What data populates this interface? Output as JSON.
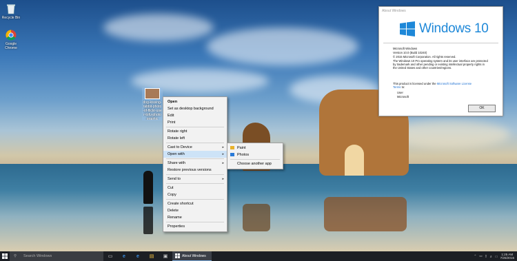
{
  "desktop": {
    "icons": [
      {
        "label": "Recycle Bin"
      },
      {
        "label": "Google Chrome"
      },
      {
        "label": "dog-kissing-rabbit-photo-of-flickr-user-tofu-photographic"
      }
    ]
  },
  "context_menu": {
    "items": [
      {
        "label": "Open",
        "bold": true
      },
      {
        "label": "Set as desktop background"
      },
      {
        "label": "Edit"
      },
      {
        "label": "Print"
      },
      {
        "label": "Rotate right"
      },
      {
        "label": "Rotate left"
      },
      {
        "label": "Cast to Device"
      },
      {
        "label": "Open with"
      },
      {
        "label": "Share with"
      },
      {
        "label": "Restore previous versions"
      },
      {
        "label": "Send to"
      },
      {
        "label": "Cut"
      },
      {
        "label": "Copy"
      },
      {
        "label": "Create shortcut"
      },
      {
        "label": "Delete"
      },
      {
        "label": "Rename"
      },
      {
        "label": "Properties"
      }
    ]
  },
  "open_with_menu": {
    "items": [
      {
        "label": "Paint"
      },
      {
        "label": "Photos"
      },
      {
        "label": "Choose another app"
      }
    ]
  },
  "about_window": {
    "title": "About Windows",
    "logo_text": "Windows 10",
    "product": "Microsoft Windows",
    "version": "Version 10.0 (Build 10240)",
    "copyright": "© 2015 Microsoft Corporation. All rights reserved.",
    "legal_1": "The Windows 10 Pro operating system and its user interface are protected",
    "legal_2": "by trademark and other pending or existing intellectual property rights in",
    "legal_3": "the United States and other countries/regions.",
    "license_prefix": "This product is licensed under the",
    "license_link": "Microsoft Software License",
    "license_link_2": "Terms",
    "license_suffix": "to:",
    "licensee_user": "User",
    "licensee_org": "Microsoft",
    "ok_label": "OK"
  },
  "taskbar": {
    "search_placeholder": "Search Windows",
    "running_app": "About Windows",
    "time": "1:25 AM",
    "date": "7/25/2015"
  },
  "colors": {
    "accent": "#1e88d8",
    "taskbar": "#1c1f24",
    "menu_highlight": "#cde3f7"
  }
}
